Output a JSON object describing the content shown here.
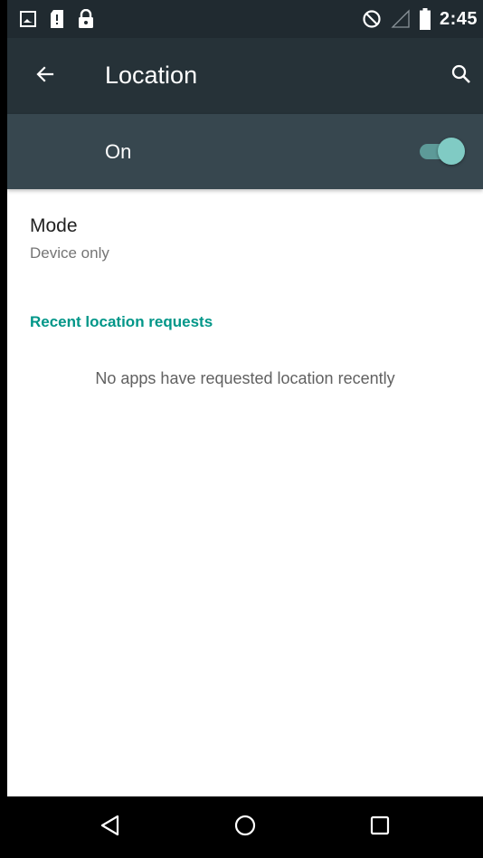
{
  "status_bar": {
    "time": "2:45",
    "left_icons": [
      "image-icon",
      "sd-card-icon",
      "lock-icon"
    ],
    "right_icons": [
      "do-not-disturb-icon",
      "signal-icon",
      "battery-icon"
    ]
  },
  "toolbar": {
    "title": "Location",
    "back_icon": "arrow-back-icon",
    "search_icon": "search-icon"
  },
  "master_switch": {
    "label": "On",
    "checked": true,
    "accent_color": "#80cbc4"
  },
  "mode": {
    "title": "Mode",
    "summary": "Device only"
  },
  "recent_requests": {
    "header": "Recent location requests",
    "empty_text": "No apps have requested location recently",
    "header_color": "#009688"
  },
  "nav_bar": {
    "buttons": [
      "back-icon",
      "home-icon",
      "recents-icon"
    ]
  }
}
